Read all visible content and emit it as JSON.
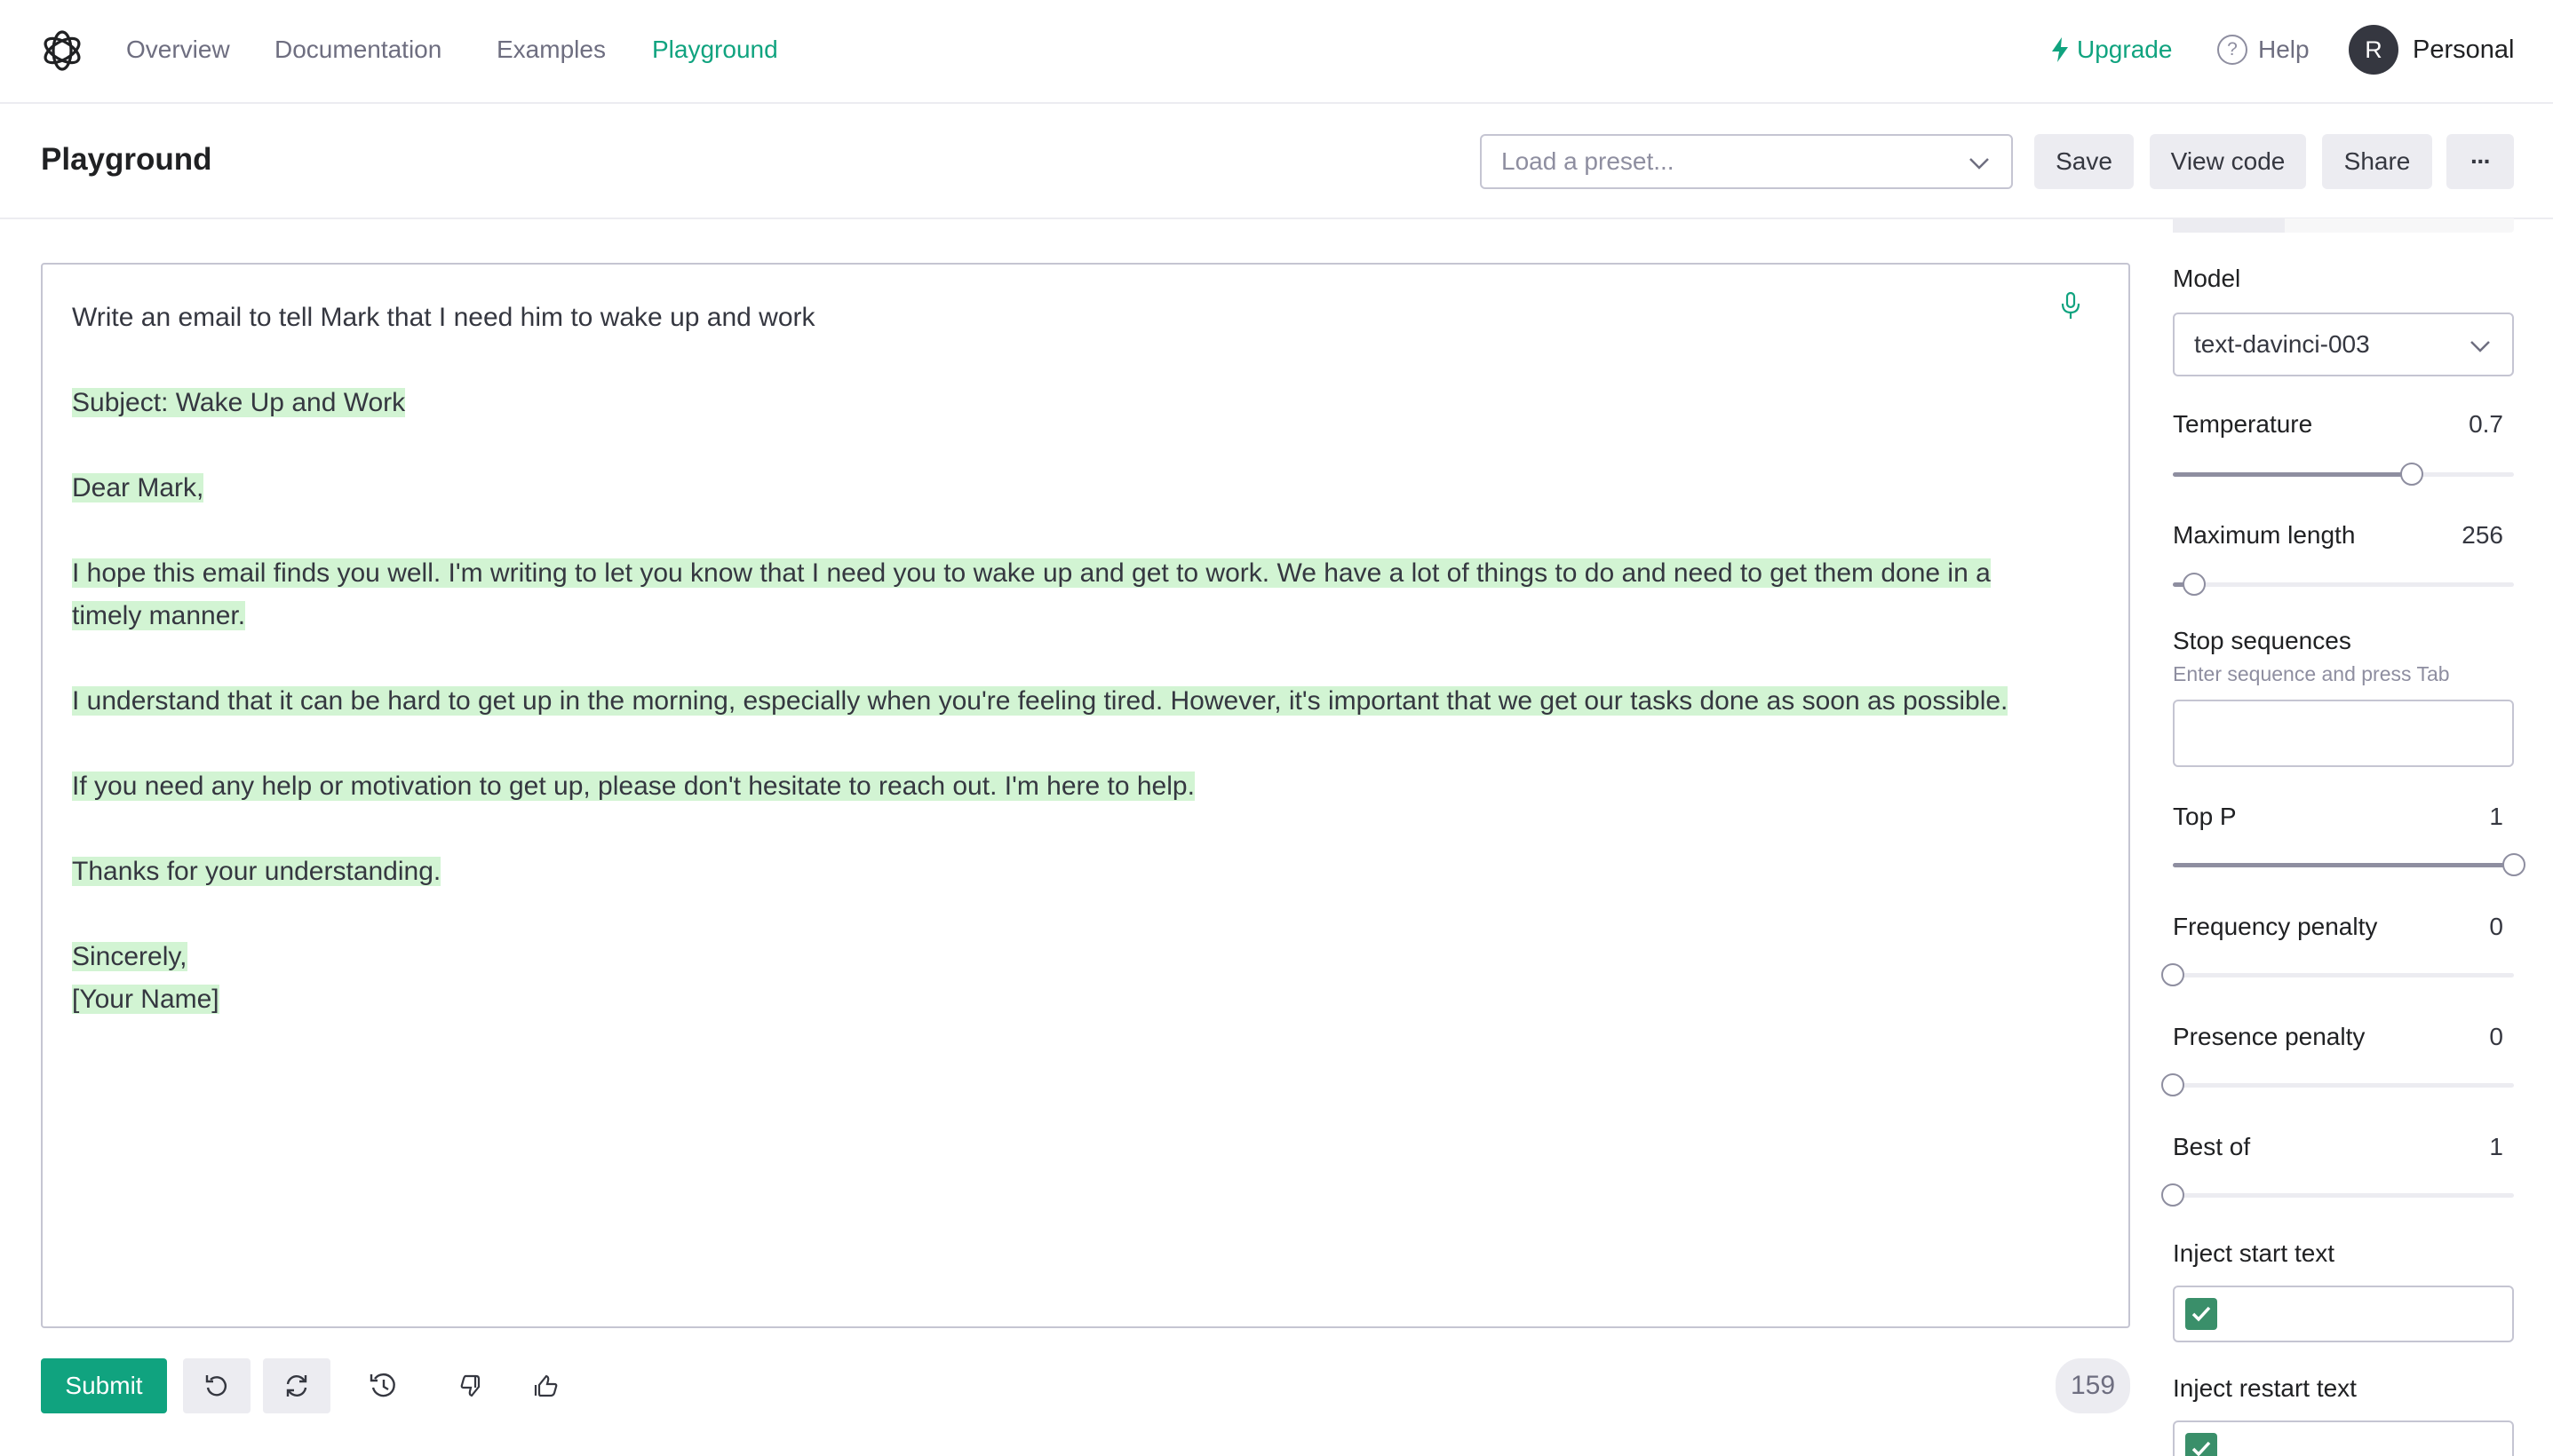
{
  "nav": {
    "links": [
      "Overview",
      "Documentation",
      "Examples",
      "Playground"
    ],
    "active": "Playground",
    "upgrade": "Upgrade",
    "help": "Help",
    "avatar_initial": "R",
    "org": "Personal"
  },
  "header": {
    "title": "Playground",
    "preset_placeholder": "Load a preset...",
    "save": "Save",
    "view_code": "View code",
    "share": "Share",
    "more": "···"
  },
  "editor": {
    "prompt": "Write an email to tell Mark that I need him to wake up and work",
    "completion": [
      "Subject: Wake Up and Work",
      "Dear Mark,",
      "I hope this email finds you well. I'm writing to let you know that I need you to wake up and get to work. We have a lot of things to do and need to get them done in a timely manner.",
      "I understand that it can be hard to get up in the morning, especially when you're feeling tired. However, it's important that we get our tasks done as soon as possible.",
      "If you need any help or motivation to get up, please don't hesitate to reach out. I'm here to help.",
      "Thanks for your understanding.",
      "Sincerely,",
      "[Your Name]"
    ]
  },
  "footer": {
    "submit": "Submit",
    "token_count": "159"
  },
  "settings": {
    "model_label": "Model",
    "model_value": "text-davinci-003",
    "temperature": {
      "label": "Temperature",
      "value": "0.7",
      "min": 0,
      "max": 1,
      "level": 0.7
    },
    "max_length": {
      "label": "Maximum length",
      "value": "256",
      "min": 1,
      "max": 4000,
      "level": 256
    },
    "stop_sequences": {
      "label": "Stop sequences",
      "hint": "Enter sequence and press Tab"
    },
    "top_p": {
      "label": "Top P",
      "value": "1",
      "min": 0,
      "max": 1,
      "level": 1
    },
    "frequency_penalty": {
      "label": "Frequency penalty",
      "value": "0",
      "min": 0,
      "max": 2,
      "level": 0
    },
    "presence_penalty": {
      "label": "Presence penalty",
      "value": "0",
      "min": 0,
      "max": 2,
      "level": 0
    },
    "best_of": {
      "label": "Best of",
      "value": "1",
      "min": 1,
      "max": 20,
      "level": 1
    },
    "inject_start": {
      "label": "Inject start text",
      "checked": true
    },
    "inject_restart": {
      "label": "Inject restart text",
      "checked": true
    }
  },
  "colors": {
    "accent": "#10a37f",
    "highlight": "#d2f4d3",
    "dark": "#202123",
    "muted": "#6e6e80"
  }
}
